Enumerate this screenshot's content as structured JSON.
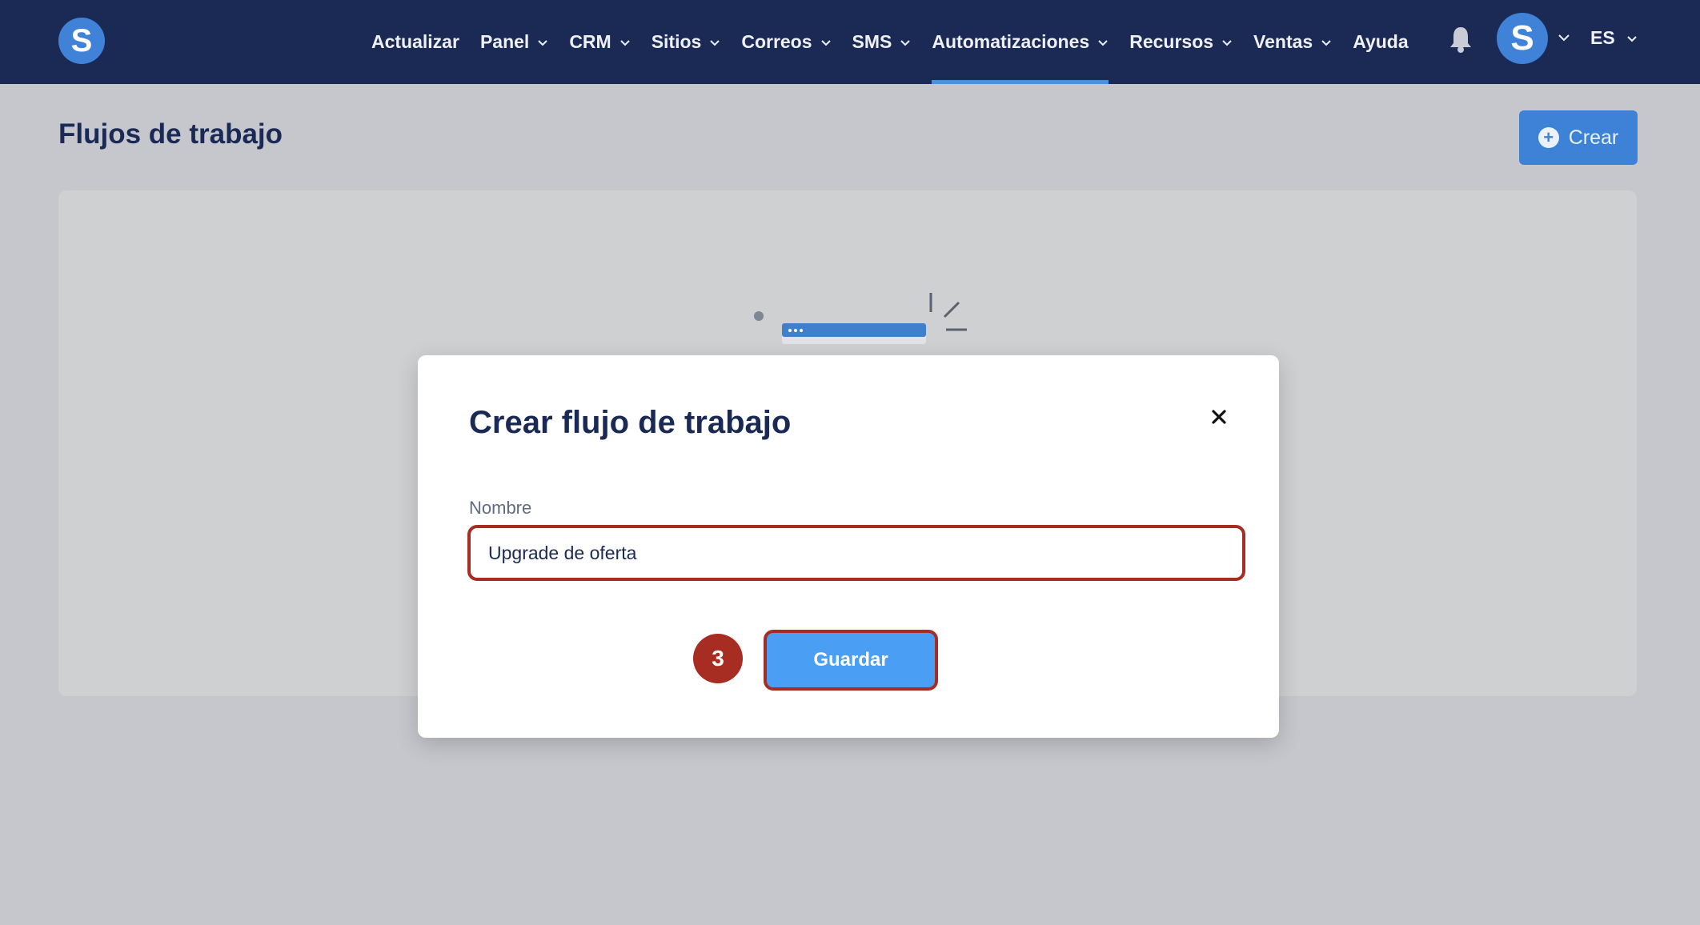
{
  "navbar": {
    "logo_letter": "S",
    "items": [
      {
        "label": "Actualizar",
        "has_dropdown": false
      },
      {
        "label": "Panel",
        "has_dropdown": true
      },
      {
        "label": "CRM",
        "has_dropdown": true
      },
      {
        "label": "Sitios",
        "has_dropdown": true
      },
      {
        "label": "Correos",
        "has_dropdown": true
      },
      {
        "label": "SMS",
        "has_dropdown": true
      },
      {
        "label": "Automatizaciones",
        "has_dropdown": true,
        "active": true
      },
      {
        "label": "Recursos",
        "has_dropdown": true
      },
      {
        "label": "Ventas",
        "has_dropdown": true
      },
      {
        "label": "Ayuda",
        "has_dropdown": false
      }
    ],
    "bell_icon": "bell-icon",
    "avatar_letter": "S",
    "language": "ES"
  },
  "page": {
    "title": "Flujos de trabajo",
    "create_button_label": "Crear"
  },
  "modal": {
    "title": "Crear flujo de trabajo",
    "close_icon": "close-icon",
    "name_label": "Nombre",
    "name_value": "Upgrade de oferta",
    "step_number": "3",
    "save_button_label": "Guardar"
  },
  "colors": {
    "navbar_bg": "#1b2a55",
    "accent_blue": "#3d82d6",
    "highlight_red": "#a72c22",
    "overlay_bg": "#c5c7cc"
  }
}
